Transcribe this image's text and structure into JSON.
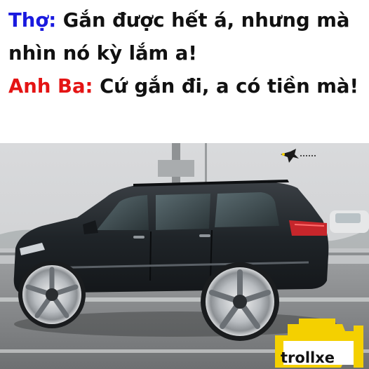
{
  "caption": {
    "line1_speaker": "Thợ:",
    "line1_text": " Gắn được hết á, nhưng mà nhìn nó kỳ lắm a!",
    "line2_speaker": "Anh Ba:",
    "line2_text": " Cứ gắn đi, a có tiền mà!"
  },
  "watermark": {
    "text": "trollxe",
    "icon": "check-engine-icon",
    "color": "#f4d000"
  },
  "photo": {
    "subject": "black SUV on oversized chrome rims",
    "icon": "car-photo"
  },
  "colors": {
    "speaker_1": "#1a1adf",
    "speaker_2": "#e41414",
    "text": "#111111"
  }
}
